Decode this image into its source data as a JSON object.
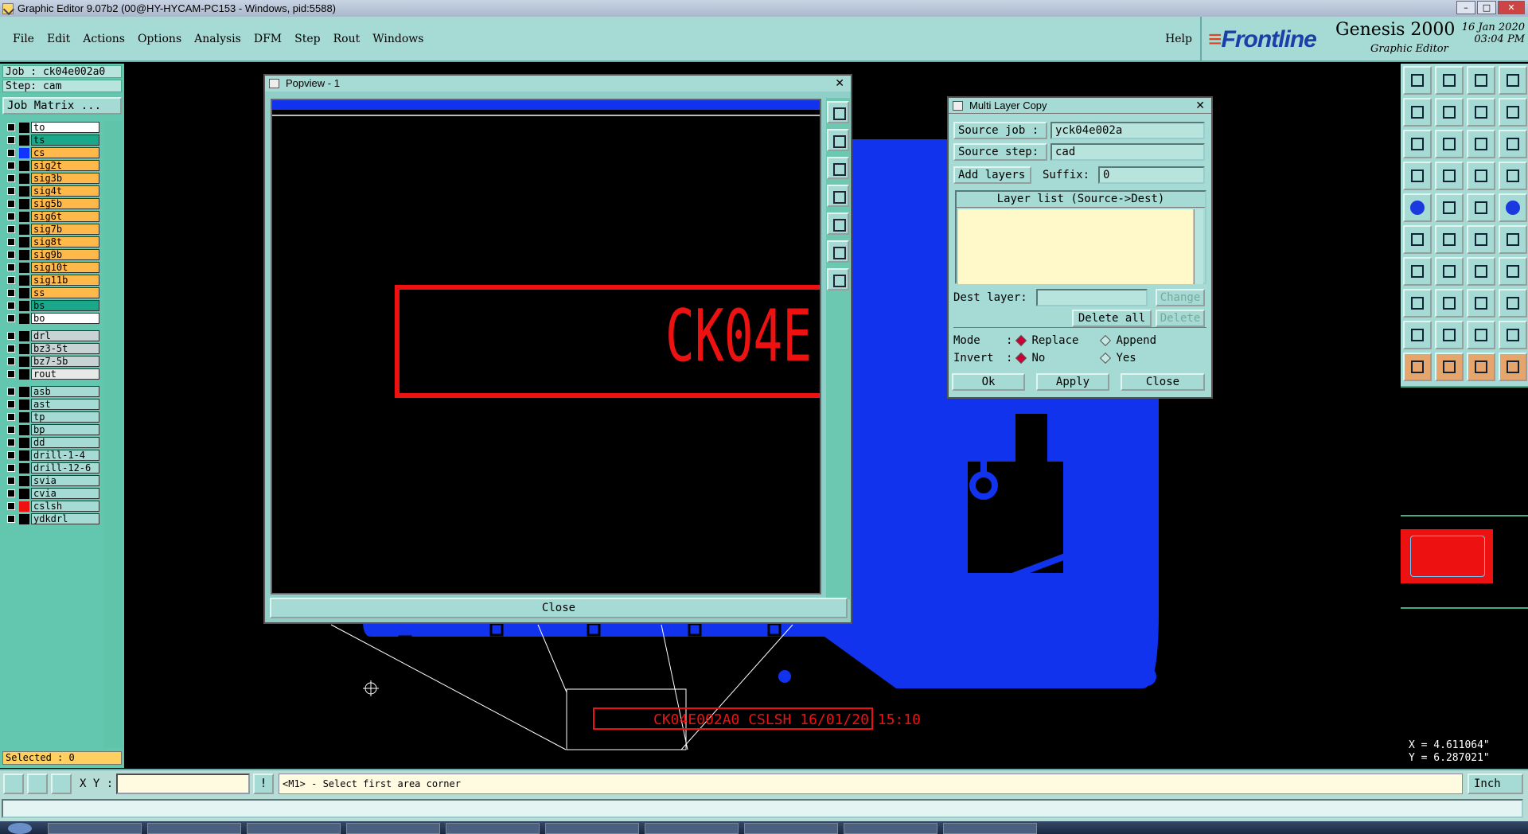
{
  "window": {
    "title": "Graphic Editor 9.07b2 (00@HY-HYCAM-PC153 - Windows, pid:5588)"
  },
  "menu": {
    "items": [
      "File",
      "Edit",
      "Actions",
      "Options",
      "Analysis",
      "DFM",
      "Step",
      "Rout",
      "Windows"
    ],
    "help": "Help"
  },
  "brand": {
    "logo": "Frontline",
    "product": "Genesis 2000",
    "subtitle": "Graphic Editor",
    "date": "16 Jan 2020",
    "time": "03:04 PM"
  },
  "job": {
    "job_label": "Job : ck04e002a0",
    "step_label": "Step: cam",
    "matrix_button": "Job Matrix ..."
  },
  "layers": [
    {
      "name": "to",
      "color": "#ffffff",
      "swatch": "#000000",
      "group": 1
    },
    {
      "name": "ts",
      "color": "#1aa78a",
      "swatch": "#000000",
      "group": 1
    },
    {
      "name": "cs",
      "color": "#ffb84a",
      "swatch": "#1133ff",
      "group": 1
    },
    {
      "name": "sig2t",
      "color": "#ffb84a",
      "swatch": "#000000",
      "group": 1
    },
    {
      "name": "sig3b",
      "color": "#ffb84a",
      "swatch": "#000000",
      "group": 1
    },
    {
      "name": "sig4t",
      "color": "#ffb84a",
      "swatch": "#000000",
      "group": 1
    },
    {
      "name": "sig5b",
      "color": "#ffb84a",
      "swatch": "#000000",
      "group": 1
    },
    {
      "name": "sig6t",
      "color": "#ffb84a",
      "swatch": "#000000",
      "group": 1
    },
    {
      "name": "sig7b",
      "color": "#ffb84a",
      "swatch": "#000000",
      "group": 1
    },
    {
      "name": "sig8t",
      "color": "#ffb84a",
      "swatch": "#000000",
      "group": 1
    },
    {
      "name": "sig9b",
      "color": "#ffb84a",
      "swatch": "#000000",
      "group": 1
    },
    {
      "name": "sig10t",
      "color": "#ffb84a",
      "swatch": "#000000",
      "group": 1
    },
    {
      "name": "sig11b",
      "color": "#ffb84a",
      "swatch": "#000000",
      "group": 1
    },
    {
      "name": "ss",
      "color": "#ffb84a",
      "swatch": "#000000",
      "group": 1
    },
    {
      "name": "bs",
      "color": "#1aa78a",
      "swatch": "#000000",
      "group": 1
    },
    {
      "name": "bo",
      "color": "#ffffff",
      "swatch": "#000000",
      "group": 1
    },
    {
      "name": "drl",
      "color": "#c8d4d4",
      "swatch": "#000000",
      "group": 2
    },
    {
      "name": "bz3-5t",
      "color": "#c8d4d4",
      "swatch": "#000000",
      "group": 2
    },
    {
      "name": "bz7-5b",
      "color": "#c8d4d4",
      "swatch": "#000000",
      "group": 2
    },
    {
      "name": "rout",
      "color": "#e8e8e8",
      "swatch": "#000000",
      "group": 2
    },
    {
      "name": "asb",
      "color": "#a6dad4",
      "swatch": "#000000",
      "group": 3
    },
    {
      "name": "ast",
      "color": "#a6dad4",
      "swatch": "#000000",
      "group": 3
    },
    {
      "name": "tp",
      "color": "#a6dad4",
      "swatch": "#000000",
      "group": 3
    },
    {
      "name": "bp",
      "color": "#a6dad4",
      "swatch": "#000000",
      "group": 3
    },
    {
      "name": "dd",
      "color": "#a6dad4",
      "swatch": "#000000",
      "group": 3
    },
    {
      "name": "drill-1-4",
      "color": "#a6dad4",
      "swatch": "#000000",
      "group": 3
    },
    {
      "name": "drill-12-6",
      "color": "#a6dad4",
      "swatch": "#000000",
      "group": 3
    },
    {
      "name": "svia",
      "color": "#a6dad4",
      "swatch": "#000000",
      "group": 3
    },
    {
      "name": "cvia",
      "color": "#a6dad4",
      "swatch": "#000000",
      "group": 3
    },
    {
      "name": "cslsh",
      "color": "#a6dad4",
      "swatch": "#ee1111",
      "group": 3
    },
    {
      "name": "ydkdrl",
      "color": "#a6dad4",
      "swatch": "#000000",
      "group": 3
    }
  ],
  "selected": "Selected : 0",
  "popview": {
    "title": "Popview - 1",
    "text": "CK04E",
    "close": "Close"
  },
  "mlc": {
    "title": "Multi Layer Copy",
    "source_job_label": "Source job :",
    "source_job": "yck04e002a",
    "source_step_label": "Source step:",
    "source_step": "cad",
    "add_layers": "Add layers",
    "suffix_label": "Suffix:",
    "suffix": "0",
    "list_header": "Layer list (Source->Dest)",
    "dest_label": "Dest layer:",
    "dest_value": "",
    "change": "Change",
    "delete_all": "Delete all",
    "delete": "Delete",
    "mode_label": "Mode",
    "replace": "Replace",
    "append": "Append",
    "invert_label": "Invert",
    "no": "No",
    "yes": "Yes",
    "ok": "Ok",
    "apply": "Apply",
    "close": "Close"
  },
  "board": {
    "label": "CK04E002A0 CSLSH 16/01/20 15:10"
  },
  "coords": {
    "x": "X = 4.611064\"",
    "y": "Y = 6.287021\""
  },
  "cmd": {
    "xy_label": "X Y :",
    "prompt": "<M1> - Select first area corner",
    "unit": "Inch"
  },
  "colors": {
    "panel": "#a6dad4",
    "board_blue": "#1133ee",
    "outline_red": "#ee1111",
    "layer_orange": "#ffb84a"
  }
}
